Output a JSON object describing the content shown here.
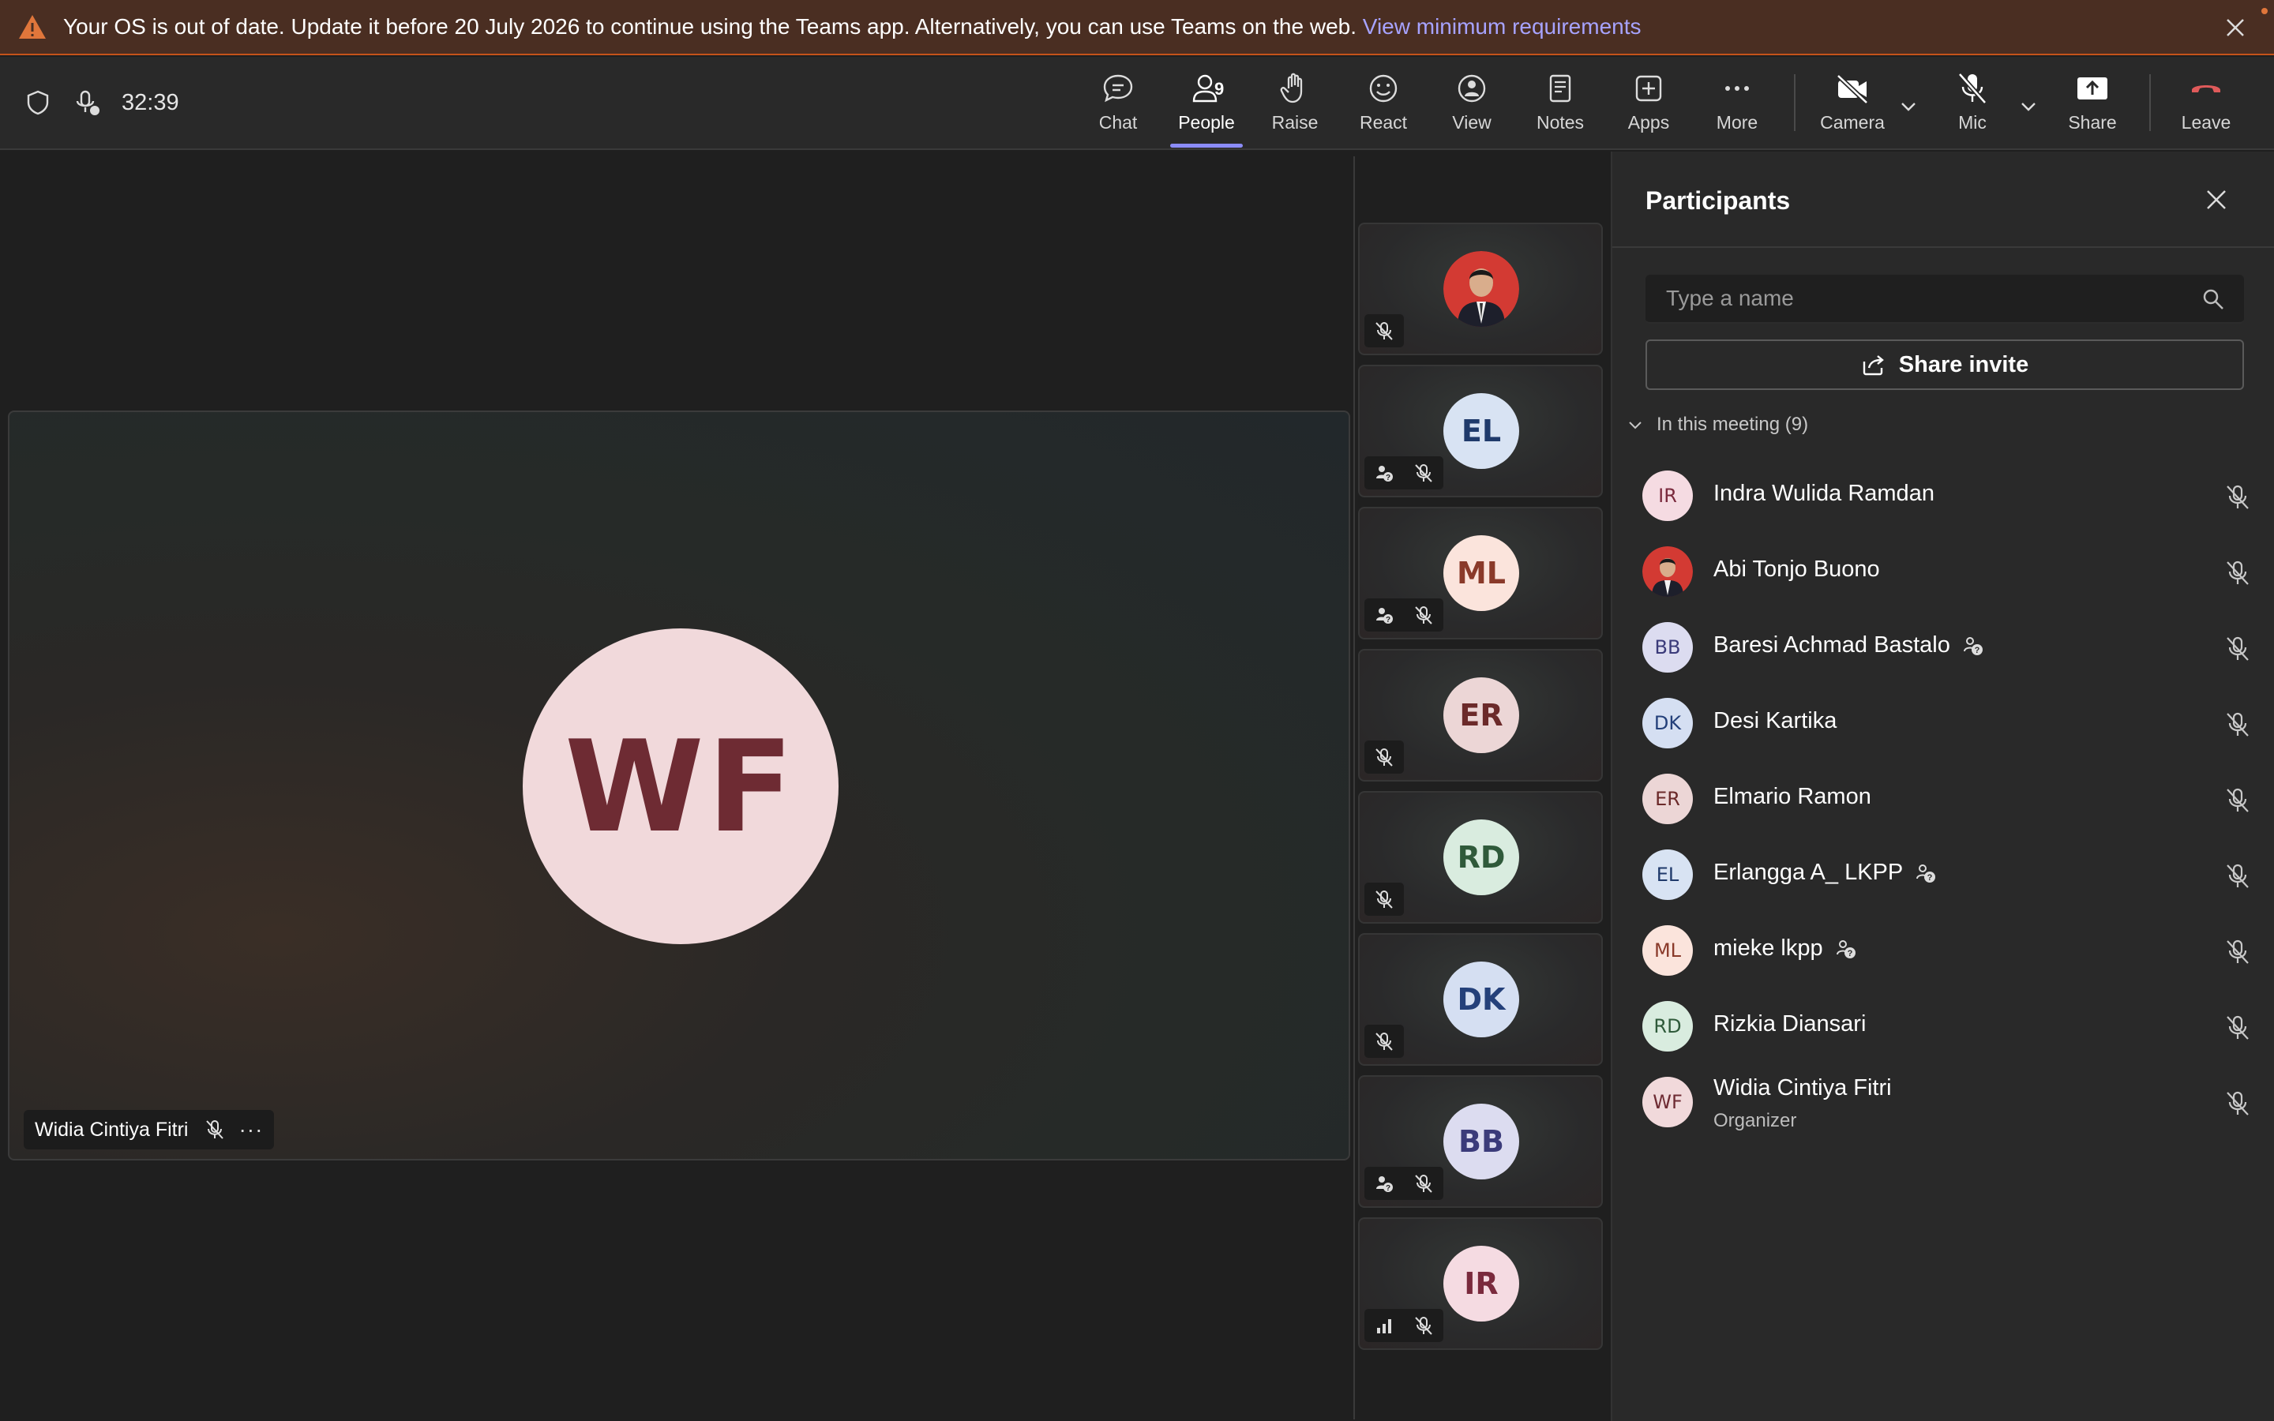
{
  "banner": {
    "message": "Your OS is out of date. Update it before 20 July 2026 to continue using the Teams app. Alternatively, you can use Teams on the web.",
    "link": "View minimum requirements",
    "warning_color": "#e0763b"
  },
  "toolbar": {
    "timer": "32:39",
    "chat": "Chat",
    "people": "People",
    "people_count": "9",
    "raise": "Raise",
    "react": "React",
    "view": "View",
    "notes": "Notes",
    "apps": "Apps",
    "more": "More",
    "camera": "Camera",
    "mic": "Mic",
    "share": "Share",
    "leave": "Leave",
    "accent": "#8b8cf8",
    "leave_color": "#e05a5a"
  },
  "stage": {
    "initials": "WF",
    "name": "Widia Cintiya Fitri"
  },
  "tiles": [
    {
      "initials": "",
      "photo": true
    },
    {
      "initials": "EL"
    },
    {
      "initials": "ML"
    },
    {
      "initials": "ER"
    },
    {
      "initials": "RD"
    },
    {
      "initials": "DK"
    },
    {
      "initials": "BB"
    },
    {
      "initials": "IR"
    }
  ],
  "panel": {
    "title": "Participants",
    "search_placeholder": "Type a name",
    "invite": "Share invite",
    "section": "In this meeting (9)",
    "participants": [
      {
        "initials": "IR",
        "name": "Indra Wulida Ramdan"
      },
      {
        "initials": "",
        "name": "Abi Tonjo Buono"
      },
      {
        "initials": "BB",
        "name": "Baresi Achmad Bastalo"
      },
      {
        "initials": "DK",
        "name": "Desi Kartika"
      },
      {
        "initials": "ER",
        "name": "Elmario Ramon"
      },
      {
        "initials": "EL",
        "name": "Erlangga A_ LKPP"
      },
      {
        "initials": "ML",
        "name": "mieke lkpp"
      },
      {
        "initials": "RD",
        "name": "Rizkia Diansari"
      },
      {
        "initials": "WF",
        "name": "Widia Cintiya Fitri",
        "role": "Organizer"
      }
    ]
  }
}
